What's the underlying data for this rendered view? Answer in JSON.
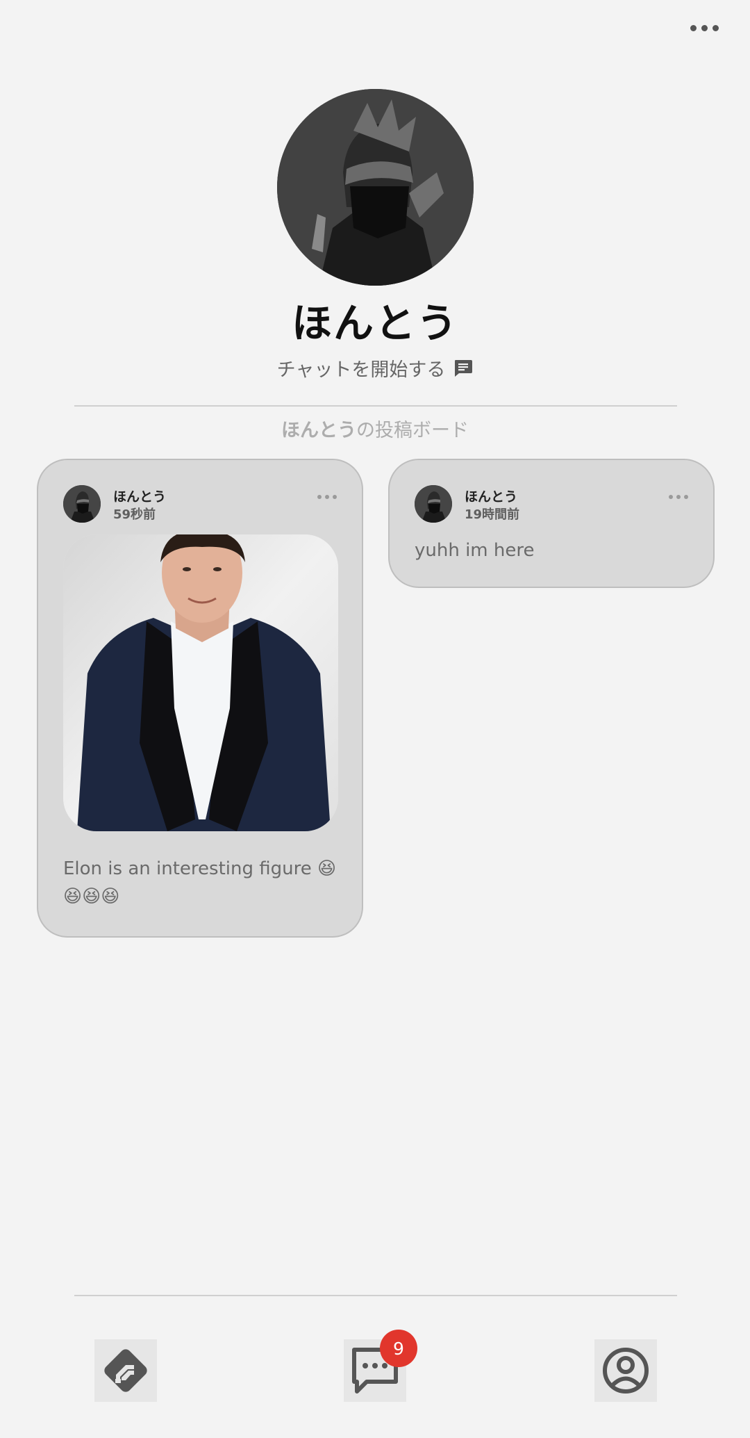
{
  "header": {
    "more_icon": "more-horizontal-icon"
  },
  "profile": {
    "name": "ほんとう",
    "start_chat_label": "チャットを開始する",
    "chat_icon": "message-icon"
  },
  "board": {
    "title_name": "ほんとう",
    "title_suffix": "の投稿ボード"
  },
  "posts": [
    {
      "author": "ほんとう",
      "time": "59秒前",
      "text": "Elon is an interesting figure 😆😆😆😆",
      "has_image": true
    },
    {
      "author": "ほんとう",
      "time": "19時間前",
      "text": "yuhh im here",
      "has_image": false
    }
  ],
  "nav": {
    "items": [
      {
        "icon": "feed-icon",
        "active": false
      },
      {
        "icon": "chat-bubble-icon",
        "active": false
      },
      {
        "icon": "profile-circle-icon",
        "active": false
      }
    ],
    "badge_count": "9"
  },
  "colors": {
    "background": "#f3f3f3",
    "card": "#d9d9d9",
    "badge": "#e1362c",
    "icon": "#555555"
  }
}
